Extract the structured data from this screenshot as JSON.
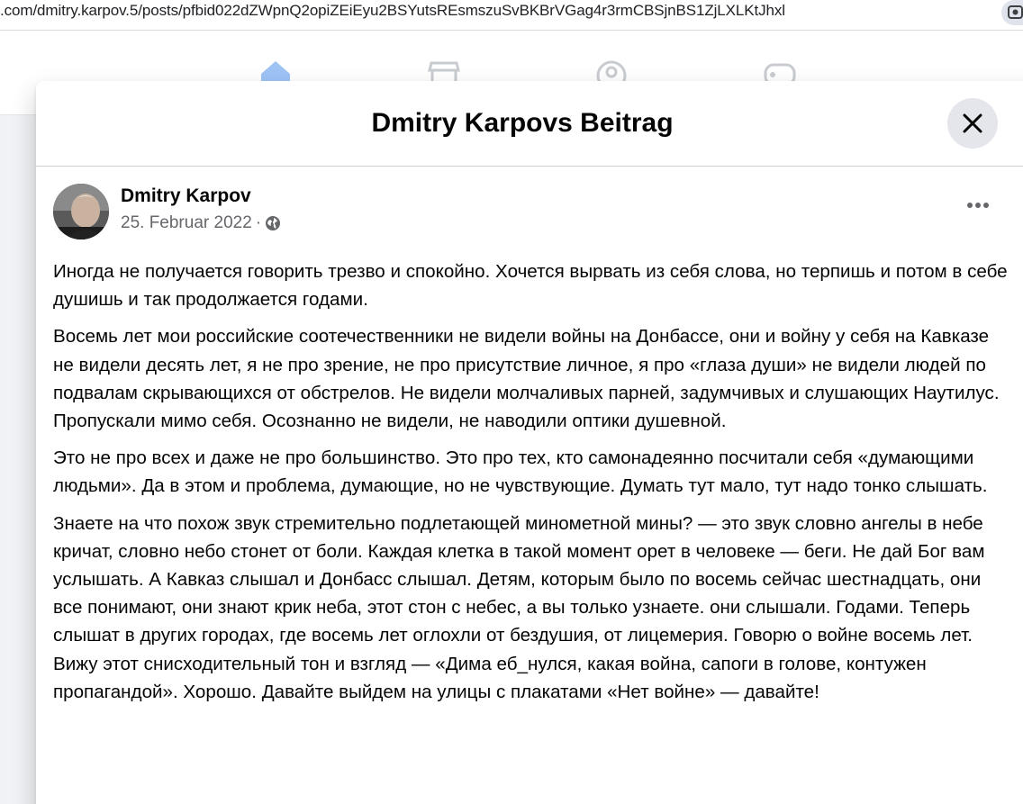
{
  "browser": {
    "url": ".com/dmitry.karpov.5/posts/pfbid022dZWpnQ2opiZEiEyu2BSYutsREsmszuSvBKBrVGag4r3rmCBSjnBS1ZjLXLKtJhxl"
  },
  "modal": {
    "title": "Dmitry Karpovs Beitrag"
  },
  "post": {
    "author": "Dmitry Karpov",
    "date": "25. Februar 2022",
    "separator": "·",
    "paragraphs": [
      "Иногда не получается говорить трезво и спокойно. Хочется вырвать из себя слова, но терпишь и потом в себе душишь и так продолжается годами.",
      "Восемь лет мои российские соотечественники не видели войны на Донбассе, они и войну у себя на Кавказе не видели десять лет, я не про зрение, не про присутствие личное, я про «глаза души» не видели людей по подвалам скрывающихся от обстрелов. Не видели молчаливых парней, задумчивых и слушающих Наутилус. Пропускали мимо себя. Осознанно не видели, не наводили оптики душевной.",
      "Это не про всех и даже не про большинство. Это про тех, кто самонадеянно посчитали себя «думающими людьми». Да в этом и проблема, думающие, но не чувствующие. Думать тут мало, тут надо тонко слышать.",
      "Знаете на что похож звук стремительно подлетающей минометной мины? — это звук словно ангелы в небе кричат, словно небо стонет от боли. Каждая клетка в такой момент орет в человеке — беги. Не дай Бог вам услышать. А Кавказ слышал и Донбасс слышал. Детям, которым было по восемь сейчас шестнадцать, они все понимают, они знают крик неба, этот стон с небес, а вы только узнаете. они слышали. Годами. Теперь слышат в других городах, где восемь лет оглохли от бездушия, от лицемерия. Говорю о войне восемь лет. Вижу этот снисходительный тон и взгляд — «Дима еб_нулся, какая война, сапоги в голове, контужен пропагандой». Хорошо. Давайте выйдем на улицы с плакатами «Нет войне» — давайте!"
    ]
  },
  "colors": {
    "accent": "#1877f2",
    "text": "#050505",
    "secondary": "#65676b",
    "divider": "#ced0d4"
  },
  "icons": {
    "close": "close-icon",
    "more": "more-icon",
    "privacy": "globe-icon",
    "lens": "google-lens-icon"
  }
}
